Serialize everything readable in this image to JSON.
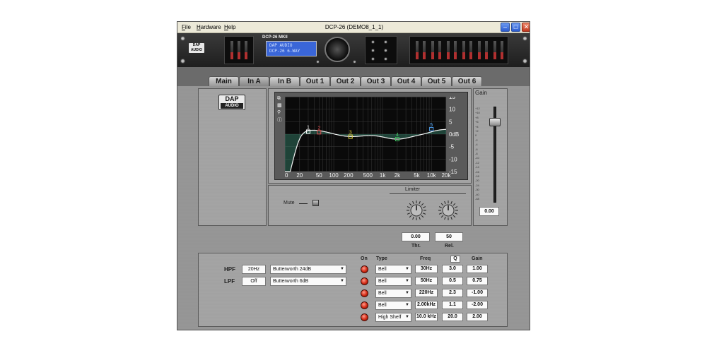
{
  "menu": {
    "file": "File",
    "hardware": "Hardware",
    "help": "Help"
  },
  "window": {
    "title": "DCP-26 (DEMO8_1_1)"
  },
  "rack": {
    "model": "DCP-26 MKII",
    "lcd_line1": "DAP AUDIO",
    "lcd_line2": "DCP-26 6-WAY",
    "logo_line1": "DAP",
    "logo_line2": "AUDIO"
  },
  "tabs": [
    "Main",
    "In A",
    "In B",
    "Out 1",
    "Out 2",
    "Out 3",
    "Out 4",
    "Out 5",
    "Out 6"
  ],
  "active_tab": "In A",
  "logo": {
    "line1": "DAP",
    "line2": "AUDIO"
  },
  "graph": {
    "db_ticks": [
      "15",
      "10",
      "5",
      "0dB",
      "-5",
      "-10",
      "-15"
    ],
    "freq_ticks": [
      "10",
      "20",
      "50",
      "100",
      "200",
      "500",
      "1k",
      "2k",
      "5k",
      "10k",
      "20k"
    ],
    "band_markers": [
      {
        "label": "1",
        "freq": 30,
        "gain": 1.0,
        "color": "#ffffff"
      },
      {
        "label": "2",
        "freq": 50,
        "gain": 0.75,
        "color": "#e05050"
      },
      {
        "label": "3",
        "freq": 220,
        "gain": -1.0,
        "color": "#e0d040"
      },
      {
        "label": "4",
        "freq": 2000,
        "gain": -2.0,
        "color": "#40c060"
      },
      {
        "label": "5",
        "freq": 10000,
        "gain": 2.0,
        "color": "#50a8ff"
      }
    ]
  },
  "gain": {
    "label": "Gain",
    "value": "0.00",
    "ticks": [
      "+12",
      "+10",
      "+8",
      "+6",
      "+4",
      "+2",
      "0",
      "-2",
      "-4",
      "-6",
      "-8",
      "-10",
      "-12",
      "-14",
      "-16",
      "-18",
      "-20",
      "-24",
      "-30",
      "-40",
      "-48"
    ]
  },
  "mute": {
    "label": "Mute"
  },
  "limiter": {
    "label": "Limiter",
    "threshold": "0.00",
    "release": "50",
    "thr_label": "Thr.",
    "rel_label": "Rel."
  },
  "filters": {
    "hpf": {
      "label": "HPF",
      "freq": "20Hz",
      "type": "Butterworth 24dB"
    },
    "lpf": {
      "label": "LPF",
      "freq": "Off",
      "type": "Butterworth 6dB"
    }
  },
  "eq": {
    "headers": {
      "on": "On",
      "type": "Type",
      "freq": "Freq",
      "q": "Q",
      "gain": "Gain"
    },
    "bands": [
      {
        "type": "Bell",
        "freq": "30Hz",
        "q": "3.0",
        "gain": "1.00"
      },
      {
        "type": "Bell",
        "freq": "50Hz",
        "q": "0.5",
        "gain": "0.75"
      },
      {
        "type": "Bell",
        "freq": "220Hz",
        "q": "2.3",
        "gain": "-1.00"
      },
      {
        "type": "Bell",
        "freq": "2.00kHz",
        "q": "1.1",
        "gain": "-2.00"
      },
      {
        "type": "High Shelf",
        "freq": "10.0 kHz",
        "q": "20.0",
        "gain": "2.00"
      }
    ]
  }
}
